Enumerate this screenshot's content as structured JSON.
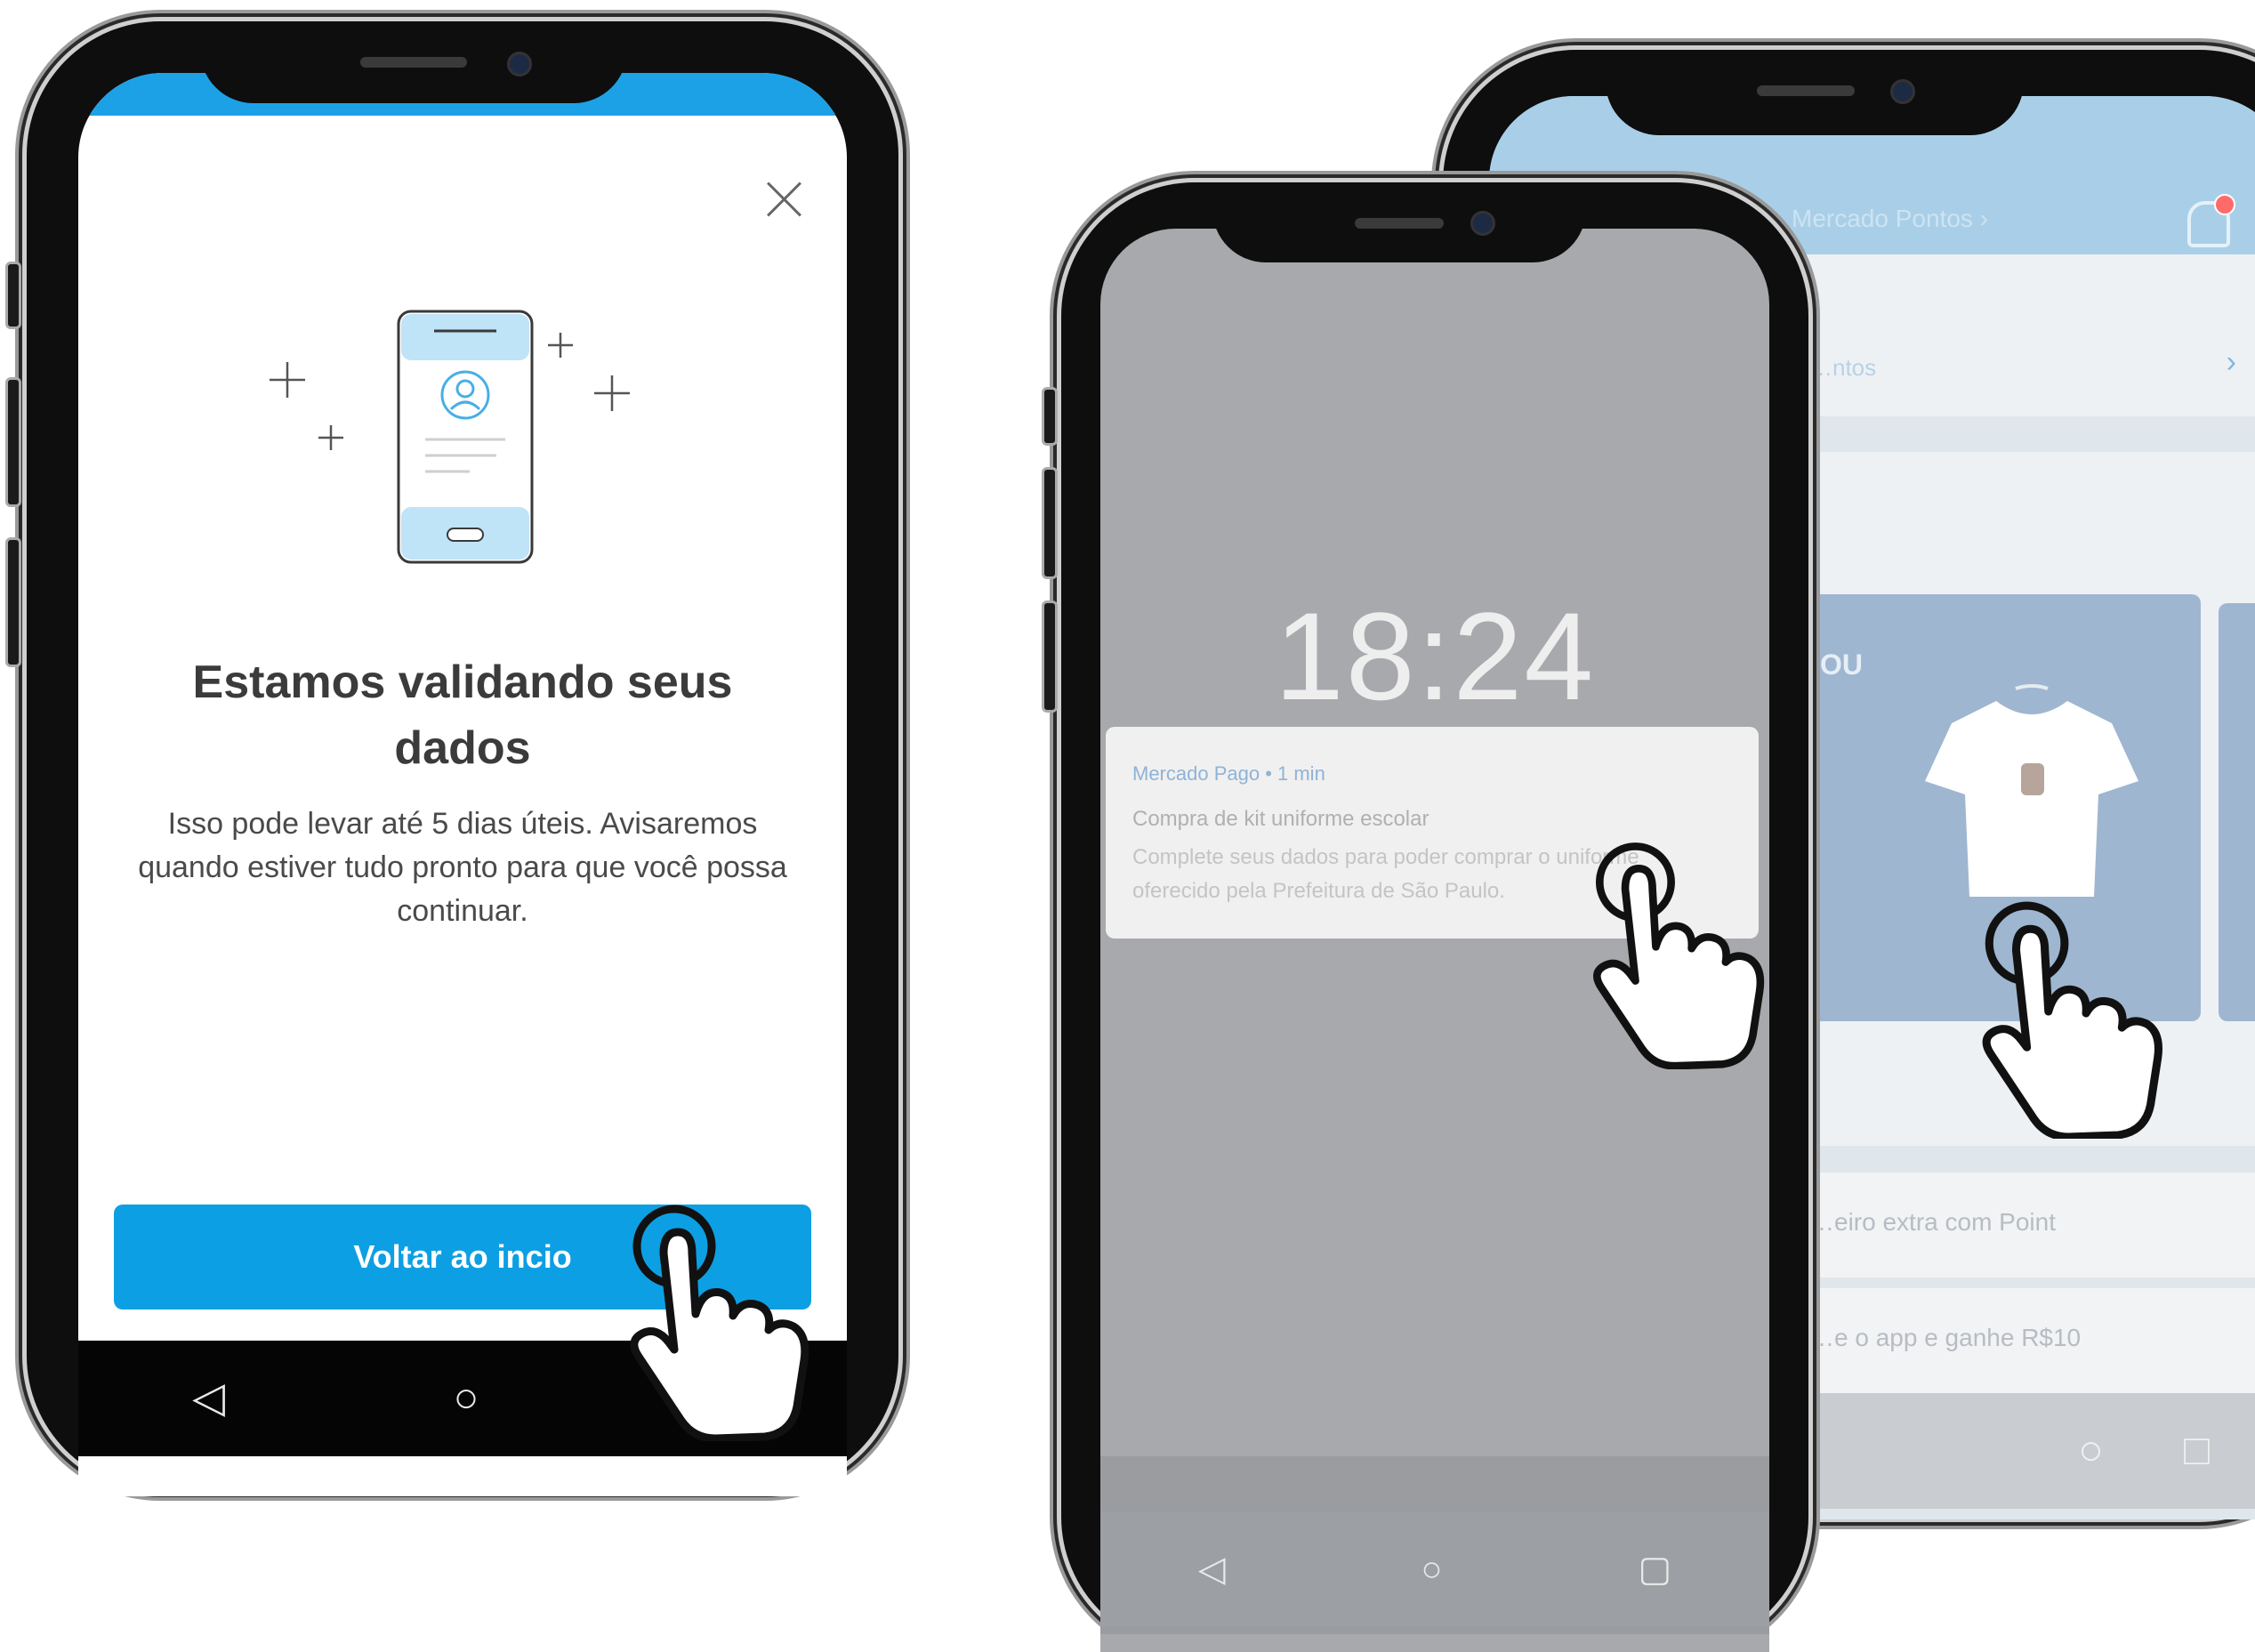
{
  "phone_left": {
    "title": "Estamos validando seus dados",
    "description": "Isso pode levar até 5 dias úteis. Avisaremos quando estiver tudo pronto para que você possa continuar.",
    "primary_button": "Voltar ao incio",
    "close_icon": "close-icon",
    "nav": {
      "back": "◁",
      "home": "○",
      "recent": "□"
    },
    "colors": {
      "accent": "#0d9fe3",
      "top_band": "#1da1e6"
    }
  },
  "phone_center": {
    "clock": "18:24",
    "notification": {
      "app": "Mercado Pago • 1 min",
      "title": "Compra de kit uniforme escolar",
      "body": "Complete seus dados para poder comprar o uniforme oferecido pela Prefeitura de São Paulo."
    },
    "nav": {
      "back": "◁",
      "home": "○",
      "recent": "▢"
    }
  },
  "phone_right": {
    "header_link": "Mercado Pontos  ›",
    "card_link": "…ntos",
    "card_chevron": "›",
    "promo_text": "…OU\nR\nS",
    "row1": "…eiro extra com Point",
    "row2": "…e o app e ganhe R$10",
    "nav": {
      "home": "○",
      "recent": "□"
    },
    "colors": {
      "header": "#a9cfe8"
    }
  }
}
